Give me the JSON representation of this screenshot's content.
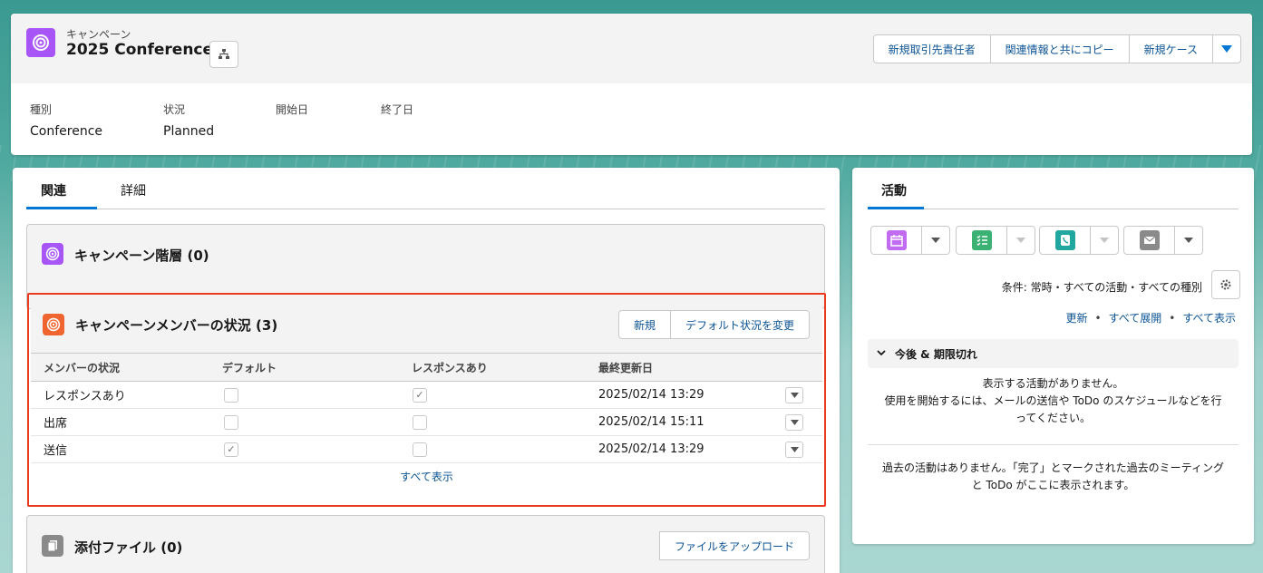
{
  "header": {
    "object_label": "キャンペーン",
    "record_title": "2025 Conference",
    "actions": [
      "新規取引先責任者",
      "関連情報と共にコピー",
      "新規ケース"
    ],
    "fields": [
      {
        "label": "種別",
        "value": "Conference"
      },
      {
        "label": "状況",
        "value": "Planned"
      },
      {
        "label": "開始日",
        "value": ""
      },
      {
        "label": "終了日",
        "value": ""
      }
    ]
  },
  "tabs": [
    "関連",
    "詳細"
  ],
  "related": {
    "hierarchy_title": "キャンペーン階層 (0)",
    "members": {
      "title": "キャンペーンメンバーの状況 (3)",
      "buttons": [
        "新規",
        "デフォルト状況を変更"
      ],
      "columns": [
        "メンバーの状況",
        "デフォルト",
        "レスポンスあり",
        "最終更新日"
      ],
      "rows": [
        {
          "status": "レスポンスあり",
          "default": false,
          "responded": true,
          "updated": "2025/02/14 13:29"
        },
        {
          "status": "出席",
          "default": false,
          "responded": false,
          "updated": "2025/02/14 15:11"
        },
        {
          "status": "送信",
          "default": true,
          "responded": false,
          "updated": "2025/02/14 13:29"
        }
      ],
      "view_all": "すべて表示"
    },
    "files": {
      "title": "添付ファイル (0)",
      "upload_label": "ファイルをアップロード"
    }
  },
  "activity": {
    "tab": "活動",
    "filter_text": "条件: 常時・すべての活動・すべての種別",
    "links": [
      "更新",
      "すべて展開",
      "すべて表示"
    ],
    "section_title": "今後 & 期限切れ",
    "empty_upcoming_1": "表示する活動がありません。",
    "empty_upcoming_2": "使用を開始するには、メールの送信や ToDo のスケジュールなどを行",
    "empty_upcoming_3": "ってください。",
    "empty_past_1": "過去の活動はありません。「完了」とマークされた過去のミーティング",
    "empty_past_2": "と ToDo がここに表示されます。"
  },
  "colors": {
    "campaign": "#a855f7",
    "members_icon": "#f0642f",
    "files_icon": "#8a8a8a",
    "event": "#c06bf0",
    "task": "#3bb273",
    "call": "#20a8a0",
    "email": "#8a8a8a",
    "link": "#0b5394",
    "highlight": "#ea3b1f"
  }
}
